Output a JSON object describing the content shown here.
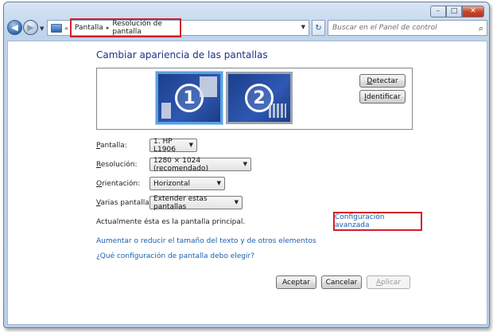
{
  "window": {
    "minimize_icon": "minimize-icon",
    "maximize_icon": "maximize-icon",
    "close_icon": "close-icon"
  },
  "nav": {
    "history_glyph": "«",
    "breadcrumb": [
      "Pantalla",
      "Resolución de pantalla"
    ],
    "breadcrumb_sep": "▸",
    "search_placeholder": "Buscar en el Panel de control",
    "refresh_glyph": "↻",
    "search_glyph": "⚲"
  },
  "main": {
    "title": "Cambiar apariencia de las pantallas",
    "monitors": [
      {
        "number": "1",
        "selected": true
      },
      {
        "number": "2",
        "selected": false
      }
    ],
    "detect_label_u": "D",
    "detect_label_rest": "etectar",
    "identify_label_u": "I",
    "identify_label_rest": "dentificar",
    "fields": {
      "display": {
        "label_u": "P",
        "label_rest": "antalla:",
        "value": "1. HP L1906"
      },
      "resolution": {
        "label_u": "R",
        "label_rest": "esolución:",
        "value": "1280 × 1024 (recomendado)"
      },
      "orientation": {
        "label_u": "O",
        "label_rest": "rientación:",
        "value": "Horizontal"
      },
      "multiple": {
        "label_u": "V",
        "label_rest": "arias pantallas:",
        "value": "Extender estas pantallas"
      }
    },
    "primary_status": "Actualmente ésta es la pantalla principal.",
    "advanced_link": "Configuración avanzada",
    "text_size_link": "Aumentar o reducir el tamaño del texto y de otros elementos",
    "which_settings_link": "¿Qué configuración de pantalla debo elegir?",
    "buttons": {
      "accept": "Aceptar",
      "cancel": "Cancelar",
      "apply_u": "A",
      "apply_rest": "plicar"
    }
  },
  "colors": {
    "highlight_box": "#d21f2a",
    "link": "#1a5fb0",
    "title": "#1e3287"
  }
}
